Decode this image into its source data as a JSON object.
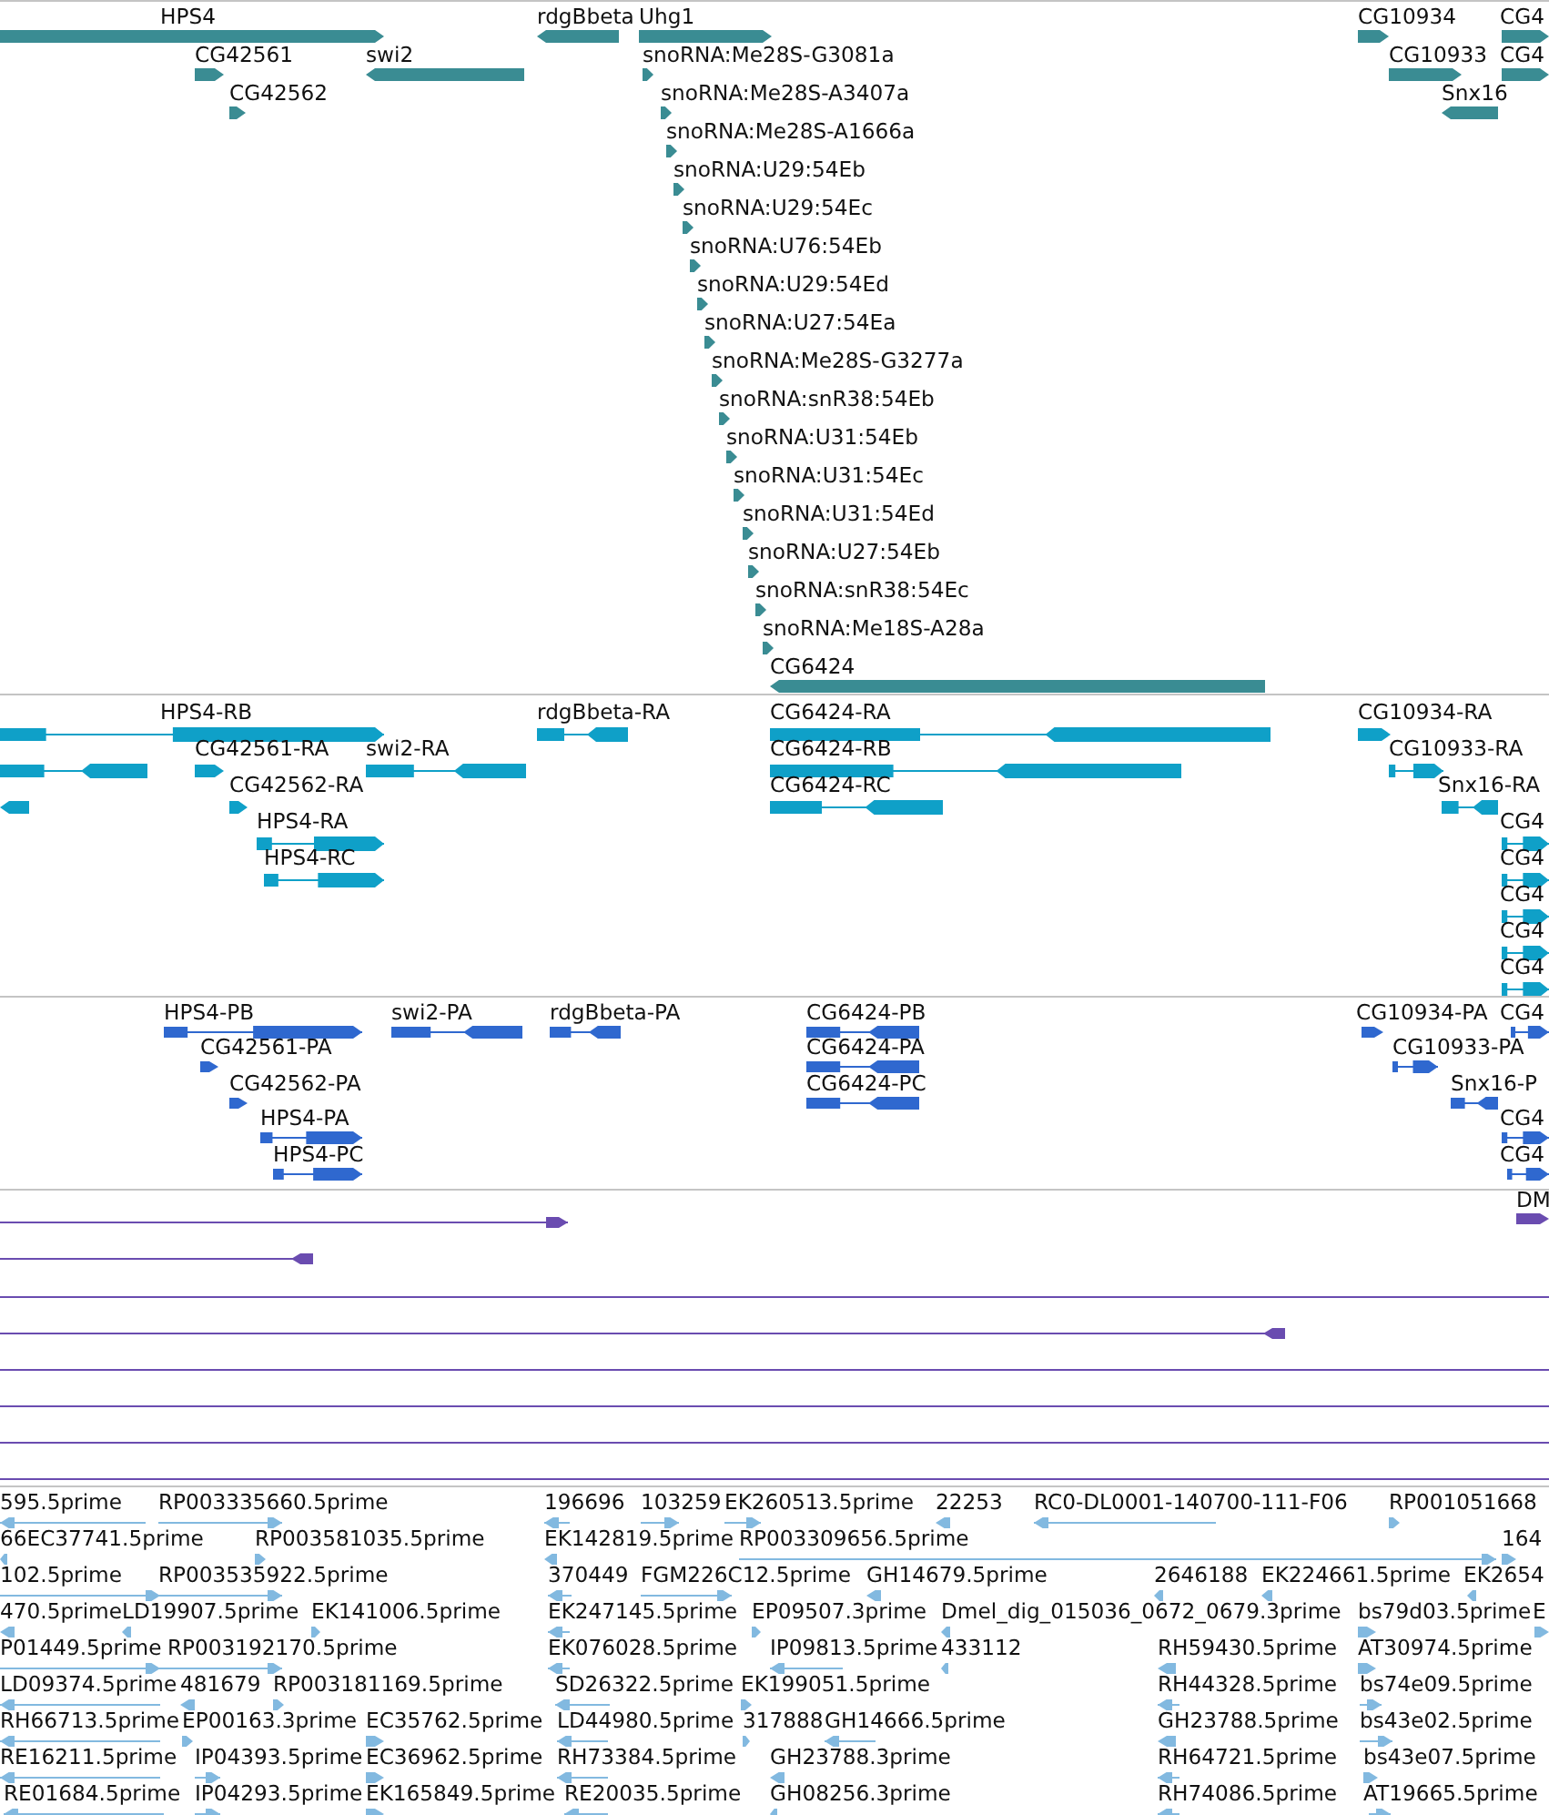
{
  "tracks": [
    {
      "kind": "gene",
      "features": [
        {
          "label": "HPS4",
          "forward": true
        },
        {
          "label": "rdgBbeta",
          "forward": false
        },
        {
          "label": "Uhg1",
          "forward": true
        },
        {
          "label": "CG10934",
          "forward": true
        },
        {
          "label": "CG4",
          "forward": true
        },
        {
          "label": "CG42561",
          "forward": true
        },
        {
          "label": "swi2",
          "forward": false
        },
        {
          "label": "snoRNA:Me28S-G3081a",
          "forward": true
        },
        {
          "label": "CG10933",
          "forward": true
        },
        {
          "label": "CG4",
          "forward": true
        },
        {
          "label": "CG42562",
          "forward": true
        },
        {
          "label": "snoRNA:Me28S-A3407a",
          "forward": true
        },
        {
          "label": "Snx16",
          "forward": false
        },
        {
          "label": "snoRNA:Me28S-A1666a",
          "forward": true
        },
        {
          "label": "snoRNA:U29:54Eb",
          "forward": true
        },
        {
          "label": "snoRNA:U29:54Ec",
          "forward": true
        },
        {
          "label": "snoRNA:U76:54Eb",
          "forward": true
        },
        {
          "label": "snoRNA:U29:54Ed",
          "forward": true
        },
        {
          "label": "snoRNA:U27:54Ea",
          "forward": true
        },
        {
          "label": "snoRNA:Me28S-G3277a",
          "forward": true
        },
        {
          "label": "snoRNA:snR38:54Eb",
          "forward": true
        },
        {
          "label": "snoRNA:U31:54Eb",
          "forward": true
        },
        {
          "label": "snoRNA:U31:54Ec",
          "forward": true
        },
        {
          "label": "snoRNA:U31:54Ed",
          "forward": true
        },
        {
          "label": "snoRNA:U27:54Eb",
          "forward": true
        },
        {
          "label": "snoRNA:snR38:54Ec",
          "forward": true
        },
        {
          "label": "snoRNA:Me18S-A28a",
          "forward": true
        },
        {
          "label": "CG6424",
          "forward": false
        }
      ]
    },
    {
      "kind": "transcript",
      "features": [
        {
          "label": "HPS4-RB",
          "forward": true
        },
        {
          "label": "rdgBbeta-RA",
          "forward": false
        },
        {
          "label": "CG6424-RA",
          "forward": false
        },
        {
          "label": "CG10934-RA",
          "forward": true
        },
        {
          "forward": false
        },
        {
          "label": "CG42561-RA",
          "forward": true
        },
        {
          "label": "swi2-RA",
          "forward": false
        },
        {
          "label": "CG6424-RB",
          "forward": false
        },
        {
          "label": "CG10933-RA",
          "forward": true
        },
        {
          "forward": false
        },
        {
          "label": "CG42562-RA",
          "forward": true
        },
        {
          "label": "CG6424-RC",
          "forward": false
        },
        {
          "label": "Snx16-RA",
          "forward": false
        },
        {
          "label": "HPS4-RA",
          "forward": true
        },
        {
          "label": "CG4",
          "forward": true
        },
        {
          "label": "HPS4-RC",
          "forward": true
        },
        {
          "label": "CG4",
          "forward": true
        },
        {
          "label": "CG4",
          "forward": true
        },
        {
          "label": "CG4",
          "forward": true
        },
        {
          "label": "CG4",
          "forward": true
        }
      ]
    },
    {
      "kind": "protein",
      "features": [
        {
          "label": "HPS4-PB",
          "forward": true
        },
        {
          "label": "swi2-PA",
          "forward": false
        },
        {
          "label": "rdgBbeta-PA",
          "forward": false
        },
        {
          "label": "CG6424-PB",
          "forward": false
        },
        {
          "label": "CG10934-PA",
          "forward": true
        },
        {
          "label": "CG4",
          "forward": true
        },
        {
          "label": "CG42561-PA",
          "forward": true
        },
        {
          "label": "CG6424-PA",
          "forward": false
        },
        {
          "label": "CG10933-PA",
          "forward": true
        },
        {
          "label": "CG42562-PA",
          "forward": true
        },
        {
          "label": "CG6424-PC",
          "forward": false
        },
        {
          "label": "Snx16-P",
          "forward": false
        },
        {
          "label": "HPS4-PA",
          "forward": true
        },
        {
          "label": "CG4",
          "forward": true
        },
        {
          "label": "HPS4-PC",
          "forward": true
        },
        {
          "label": "CG4",
          "forward": true
        }
      ]
    },
    {
      "kind": "alignment",
      "features": [
        {
          "kind": "ending",
          "forward": true
        },
        {
          "kind": "ending",
          "label": "DM",
          "forward": true
        },
        {
          "kind": "ending",
          "forward": false
        },
        {
          "kind": "through"
        },
        {
          "kind": "ending",
          "forward": false
        },
        {
          "kind": "through"
        },
        {
          "kind": "through"
        },
        {
          "kind": "through"
        },
        {
          "kind": "through"
        }
      ]
    },
    {
      "kind": "est",
      "features": [
        {
          "label": "595.5prime",
          "forward": false
        },
        {
          "label": "RP003335660.5prime",
          "forward": true
        },
        {
          "label": "196696",
          "forward": false
        },
        {
          "label": "103259",
          "forward": true
        },
        {
          "label": "EK260513.5prime",
          "forward": true
        },
        {
          "label": "22253",
          "forward": false
        },
        {
          "label": "RC0-DL0001-140700-111-F06",
          "forward": false
        },
        {
          "label": "RP001051668",
          "forward": true
        },
        {
          "label": "66EC37741.5prime",
          "forward": false
        },
        {
          "label": "RP003581035.5prime",
          "forward": true
        },
        {
          "label": "EK142819.5prime",
          "forward": false
        },
        {
          "label": "RP003309656.5prime",
          "forward": true
        },
        {
          "label": "164",
          "forward": true
        },
        {
          "label": "102.5prime",
          "forward": true
        },
        {
          "label": "RP003535922.5prime",
          "forward": true
        },
        {
          "label": "370449",
          "forward": false
        },
        {
          "label": "FGM226C12.5prime",
          "forward": true
        },
        {
          "label": "GH14679.5prime",
          "forward": false
        },
        {
          "label": "2646188",
          "forward": false
        },
        {
          "label": "EK224661.5prime",
          "forward": false
        },
        {
          "label": "EK2654",
          "forward": false
        },
        {
          "label": "470.5prime",
          "forward": false
        },
        {
          "label": "LD19907.5prime",
          "forward": false
        },
        {
          "label": "EK141006.5prime",
          "forward": true
        },
        {
          "label": "EK247145.5prime",
          "forward": false
        },
        {
          "label": "EP09507.3prime",
          "forward": true
        },
        {
          "label": "Dmel_dig_015036_0672_0679.3prime",
          "forward": false
        },
        {
          "label": "bs79d03.5prime",
          "forward": true
        },
        {
          "label": "E",
          "forward": true
        },
        {
          "label": "P01449.5prime",
          "forward": true
        },
        {
          "label": "RP003192170.5prime",
          "forward": true
        },
        {
          "label": "EK076028.5prime",
          "forward": false
        },
        {
          "label": "IP09813.5prime",
          "forward": false
        },
        {
          "label": "433112",
          "forward": false
        },
        {
          "label": "RH59430.5prime",
          "forward": false
        },
        {
          "label": "AT30974.5prime",
          "forward": true
        },
        {
          "label": "LD09374.5prime",
          "forward": false
        },
        {
          "label": "481679",
          "forward": false
        },
        {
          "label": "RP003181169.5prime",
          "forward": true
        },
        {
          "label": "SD26322.5prime",
          "forward": false
        },
        {
          "label": "EK199051.5prime",
          "forward": true
        },
        {
          "label": "RH44328.5prime",
          "forward": false
        },
        {
          "label": "bs74e09.5prime",
          "forward": true
        },
        {
          "label": "RH66713.5prime",
          "forward": false
        },
        {
          "label": "EP00163.3prime",
          "forward": true
        },
        {
          "label": "EC35762.5prime",
          "forward": true
        },
        {
          "label": "LD44980.5prime",
          "forward": false
        },
        {
          "label": "317888",
          "forward": true
        },
        {
          "label": "GH14666.5prime",
          "forward": false
        },
        {
          "label": "GH23788.5prime",
          "forward": false
        },
        {
          "label": "bs43e02.5prime",
          "forward": true
        },
        {
          "label": "RE16211.5prime",
          "forward": false
        },
        {
          "label": "IP04393.5prime",
          "forward": true
        },
        {
          "label": "EC36962.5prime",
          "forward": true
        },
        {
          "label": "RH73384.5prime",
          "forward": false
        },
        {
          "label": "GH23788.3prime",
          "forward": false
        },
        {
          "label": "RH64721.5prime",
          "forward": false
        },
        {
          "label": "bs43e07.5prime",
          "forward": true
        },
        {
          "label": "RE01684.5prime",
          "forward": false
        },
        {
          "label": "IP04293.5prime",
          "forward": true
        },
        {
          "label": "EK165849.5prime",
          "forward": true
        },
        {
          "label": "RE20035.5prime",
          "forward": false
        },
        {
          "label": "GH08256.3prime",
          "forward": false
        },
        {
          "label": "RH74086.5prime",
          "forward": false
        },
        {
          "label": "AT19665.5prime",
          "forward": true
        }
      ]
    }
  ]
}
